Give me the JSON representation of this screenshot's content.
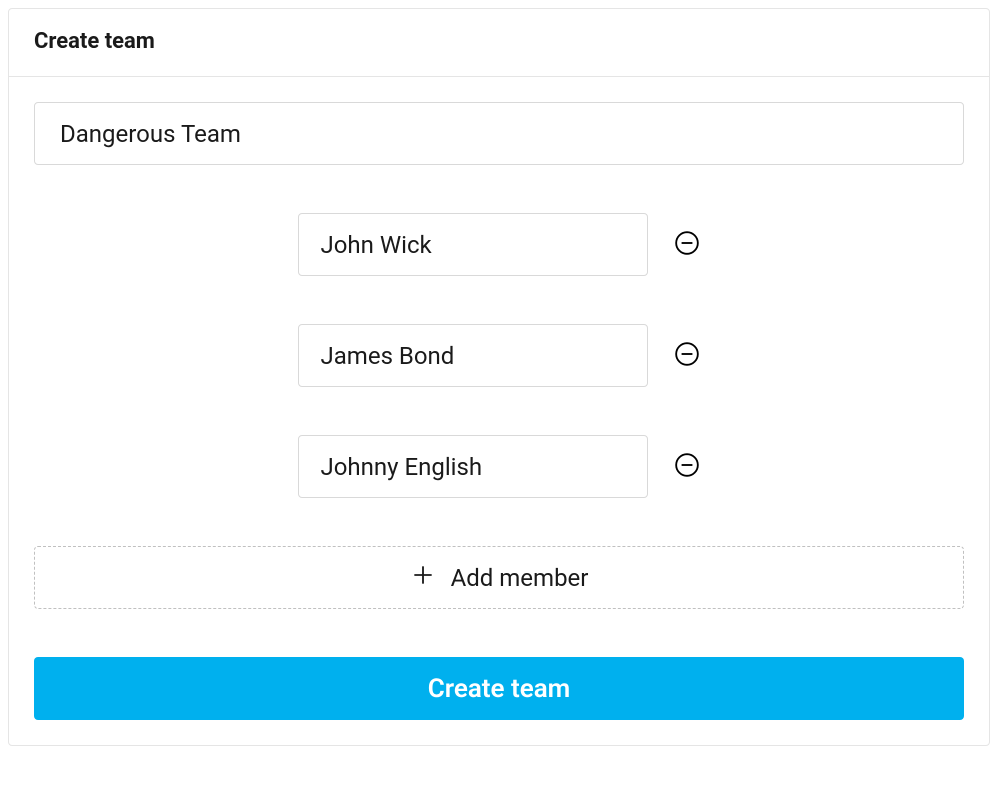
{
  "header": {
    "title": "Create team"
  },
  "form": {
    "team_name_value": "Dangerous Team",
    "members": [
      {
        "name": "John Wick"
      },
      {
        "name": "James Bond"
      },
      {
        "name": "Johnny English"
      }
    ],
    "add_member_label": "Add member",
    "submit_label": "Create team"
  },
  "colors": {
    "primary": "#00b0ee",
    "border": "#d9d9d9"
  }
}
